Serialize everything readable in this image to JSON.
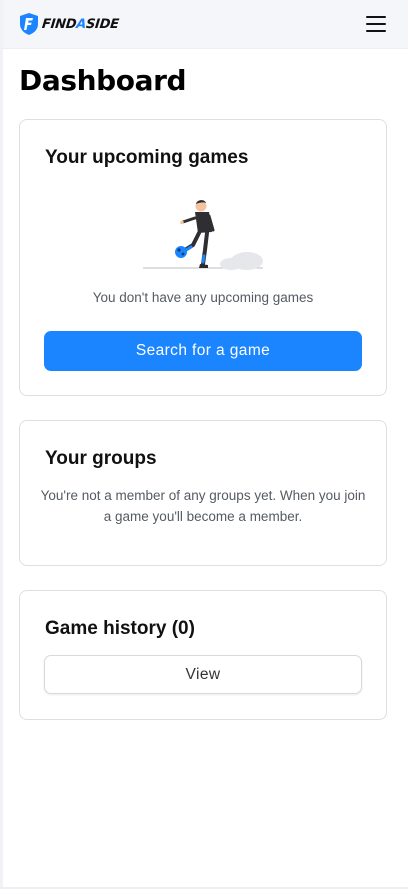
{
  "brand": {
    "logo_text_pre": "FIND",
    "logo_text_accent": "A",
    "logo_text_post": "SIDE",
    "logo_letter": "F",
    "accent_color": "#1b84ff"
  },
  "nav": {
    "menu_icon": "hamburger-menu-icon"
  },
  "page": {
    "title": "Dashboard"
  },
  "upcoming": {
    "title": "Your upcoming games",
    "illustration_icon": "footballer-illustration",
    "empty_text": "You don't have any upcoming games",
    "search_button": "Search for a game"
  },
  "groups": {
    "title": "Your groups",
    "empty_text": "You're not a member of any groups yet. When you join a game you'll become a member."
  },
  "history": {
    "title": "Game history (0)",
    "view_button": "View"
  },
  "colors": {
    "primary": "#1a85ff",
    "card_border": "#dcdfe4",
    "navbar_bg": "#f5f6f9"
  }
}
